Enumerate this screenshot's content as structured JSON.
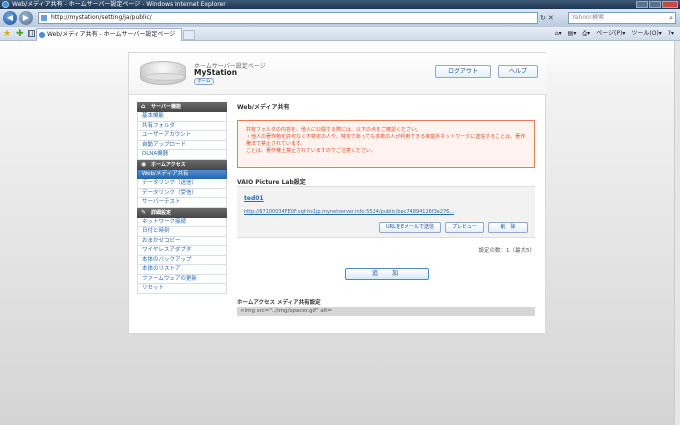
{
  "window": {
    "title": "Web/メディア共有 - ホームサーバー設定ページ - Windows Internet Explorer"
  },
  "address": {
    "url": "http://mystation/setting/ja/public/",
    "search_placeholder": "Yahoo!検索"
  },
  "tabs": [
    {
      "label": "Web/メディア共有 - ホームサーバー設定ページ"
    }
  ],
  "command_bar": {
    "page": "ページ(P)",
    "tools": "ツール(O)"
  },
  "header": {
    "subtitle": "ホームサーバー設定ページ",
    "station": "MyStation",
    "home": "ホーム",
    "logout": "ログアウト",
    "help": "ヘルプ"
  },
  "sidebar": {
    "sections": [
      {
        "title": "サーバー機能",
        "icon": "home-icon",
        "items": [
          {
            "label": "基本機能"
          },
          {
            "label": "共有フォルダ"
          },
          {
            "label": "ユーザーアカウント"
          },
          {
            "label": "自動アップロード"
          },
          {
            "label": "DLNA機器"
          }
        ]
      },
      {
        "title": "ホームアクセス",
        "icon": "globe-icon",
        "items": [
          {
            "label": "Web/メディア共有",
            "active": true
          },
          {
            "label": "データリンク（送信）"
          },
          {
            "label": "データリンク（受信）"
          },
          {
            "label": "サーバーテスト"
          }
        ]
      },
      {
        "title": "詳細設定",
        "icon": "wrench-icon",
        "items": [
          {
            "label": "ネットワーク接続"
          },
          {
            "label": "日付と時刻"
          },
          {
            "label": "おまかせコピー"
          },
          {
            "label": "ワイヤレスアダプタ"
          },
          {
            "label": "本体のバックアップ"
          },
          {
            "label": "本体のリストア"
          },
          {
            "label": "ファームウェアの更新"
          },
          {
            "label": "リセット"
          }
        ]
      }
    ]
  },
  "main": {
    "title": "Web/メディア共有",
    "notice": [
      "共有フォルダの内容を、他人に公開する際には、以下の点をご確認ください。",
      "・他人の著作物を許可なく不特定の人や、特定であっても多数の人が利用できる家庭外ネットワークに送信することは、著作権法で禁止されています。",
      "ことは、著作権上禁止されていますのでご注意ください。"
    ],
    "vaio_title": "VAIO Picture Lab設定",
    "vaio_name": "ted01",
    "vaio_url": "http://67100034FE0F.vqf-hs1jp.mynetserver.info:5524/public/bac74894126f3e276...",
    "btn_email": "URLをEメールで送信",
    "btn_preview": "プレビュー",
    "btn_delete": "削　除",
    "count": "設定の数：1（最大5）",
    "btn_add": "追　加",
    "ha_title": "ホームアクセス メディア共有設定",
    "code_text": "<img src=\"../img/spacer.gif\" alt="
  }
}
